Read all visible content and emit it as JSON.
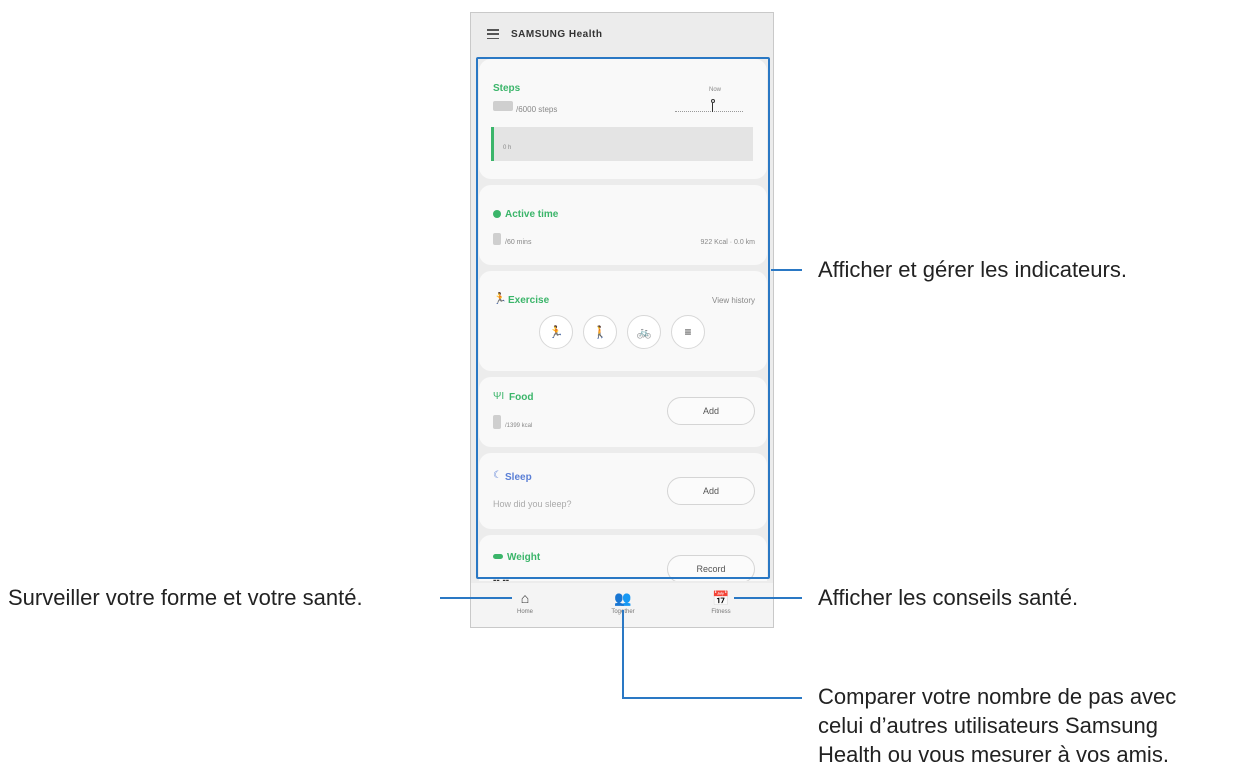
{
  "app": {
    "title": "SAMSUNG Health",
    "menu_icon": "hamburger-icon"
  },
  "cards": {
    "steps": {
      "title": "Steps",
      "goal": "/6000 steps",
      "now_label": "Now",
      "bar_text": "0 h"
    },
    "active_time": {
      "title": "Active time",
      "goal": "/60 mins",
      "stats": "922 Kcal · 0.0 km"
    },
    "exercise": {
      "title": "Exercise",
      "link": "View history",
      "icons": [
        "running-icon",
        "walking-icon",
        "cycling-icon",
        "list-icon"
      ]
    },
    "food": {
      "title": "Food",
      "goal": "/1399 kcal",
      "button": "Add"
    },
    "sleep": {
      "title": "Sleep",
      "prompt": "How did you sleep?",
      "button": "Add"
    },
    "weight": {
      "title": "Weight",
      "value": "-- --",
      "button": "Record"
    }
  },
  "nav": {
    "home": "Home",
    "together": "Together",
    "fitness": "Fitness"
  },
  "callouts": {
    "indicators": "Afficher et gérer les indicateurs.",
    "home": "Surveiller votre forme et votre santé.",
    "fitness": "Afficher les conseils santé.",
    "together_line1": "Comparer votre nombre de pas avec",
    "together_line2": "celui d’autres utilisateurs Samsung",
    "together_line3": "Health ou vous mesurer à vos amis."
  },
  "colors": {
    "accent": "#2a78c4",
    "green": "#3bb56a",
    "sleep_blue": "#5a7fd6"
  }
}
